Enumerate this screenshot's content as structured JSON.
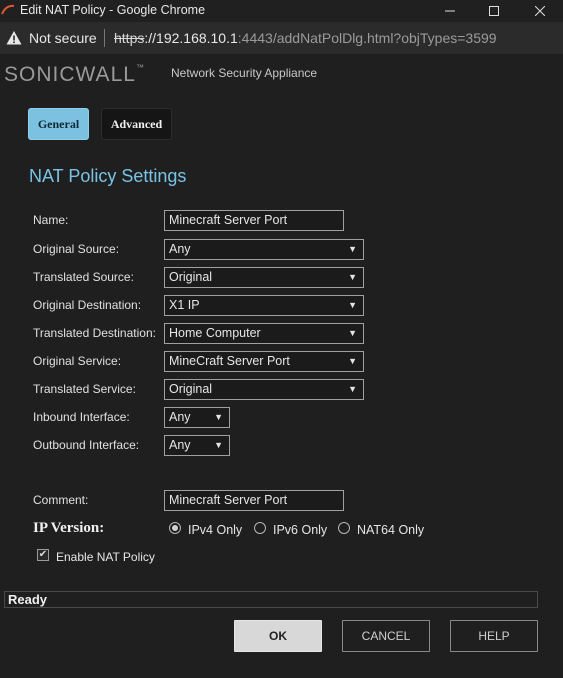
{
  "window": {
    "title": "Edit NAT Policy - Google Chrome"
  },
  "address_bar": {
    "security_label": "Not secure",
    "url_scheme": "https",
    "url_host": "://192.168.10.1",
    "url_rest": ":4443/addNatPolDlg.html?objTypes=3599"
  },
  "header": {
    "logo_part1": "SONIC",
    "logo_part2": "WALL",
    "logo_tm": "™",
    "subtitle": "Network Security Appliance"
  },
  "tabs": [
    {
      "label": "General",
      "active": true
    },
    {
      "label": "Advanced",
      "active": false
    }
  ],
  "section_title": "NAT Policy Settings",
  "form": {
    "name": {
      "label": "Name:",
      "value": "Minecraft Server Port"
    },
    "original_source": {
      "label": "Original Source:",
      "value": "Any"
    },
    "translated_source": {
      "label": "Translated Source:",
      "value": "Original"
    },
    "original_destination": {
      "label": "Original Destination:",
      "value": "X1 IP"
    },
    "translated_destination": {
      "label": "Translated Destination:",
      "value": "Home Computer"
    },
    "original_service": {
      "label": "Original Service:",
      "value": "MineCraft Server Port"
    },
    "translated_service": {
      "label": "Translated Service:",
      "value": "Original"
    },
    "inbound_interface": {
      "label": "Inbound Interface:",
      "value": "Any"
    },
    "outbound_interface": {
      "label": "Outbound Interface:",
      "value": "Any"
    },
    "comment": {
      "label": "Comment:",
      "value": "Minecraft Server Port"
    }
  },
  "ip_version": {
    "label": "IP Version:",
    "options": [
      {
        "label": "IPv4 Only",
        "selected": true
      },
      {
        "label": "IPv6 Only",
        "selected": false
      },
      {
        "label": "NAT64 Only",
        "selected": false
      }
    ]
  },
  "enable_nat": {
    "label": "Enable NAT Policy",
    "checked": true
  },
  "status": "Ready",
  "buttons": {
    "ok": "OK",
    "cancel": "CANCEL",
    "help": "HELP"
  },
  "colors": {
    "accent": "#79c3e6",
    "background": "#1f1f1f"
  }
}
